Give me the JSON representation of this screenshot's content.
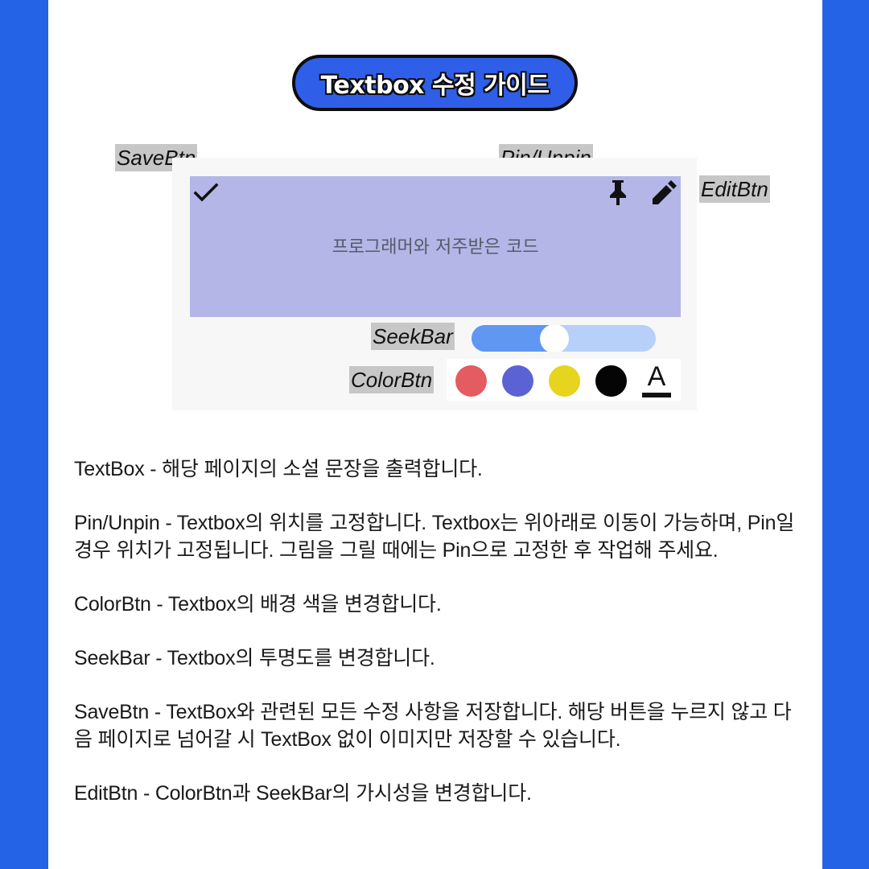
{
  "title": "Textbox 수정 가이드",
  "labels": {
    "save_btn": "SaveBtn",
    "pin_unpin": "Pin/Unpin",
    "edit_btn": "EditBtn",
    "seek_bar": "SeekBar",
    "color_btn": "ColorBtn"
  },
  "textbox": {
    "content": "프로그래머와 저주받은 코드",
    "background_color": "#b3b6e6",
    "icons": [
      "check-icon",
      "pin-icon",
      "pencil-icon"
    ]
  },
  "seekbar": {
    "value_percent": 45,
    "track_color": "#b6d0fa",
    "fill_color": "#5f97f3"
  },
  "colors": {
    "swatches": [
      "#e45b61",
      "#5b62d4",
      "#e6d41e",
      "#050505"
    ],
    "font_color_label": "A"
  },
  "descriptions": [
    "TextBox - 해당 페이지의 소설 문장을 출력합니다.",
    "Pin/Unpin - Textbox의 위치를 고정합니다. Textbox는 위아래로 이동이 가능하며, Pin일 경우 위치가 고정됩니다. 그림을 그릴 때에는 Pin으로 고정한 후 작업해 주세요.",
    "ColorBtn - Textbox의 배경 색을 변경합니다.",
    "SeekBar - Textbox의 투명도를 변경합니다.",
    "SaveBtn - TextBox와 관련된 모든 수정 사항을 저장합니다. 해당 버튼을 누르지 않고 다음 페이지로 넘어갈 시 TextBox 없이 이미지만 저장할 수 있습니다.",
    "EditBtn - ColorBtn과 SeekBar의 가시성을 변경합니다."
  ],
  "theme": {
    "frame": "#2563e6",
    "pill": "#2f5fe8"
  }
}
